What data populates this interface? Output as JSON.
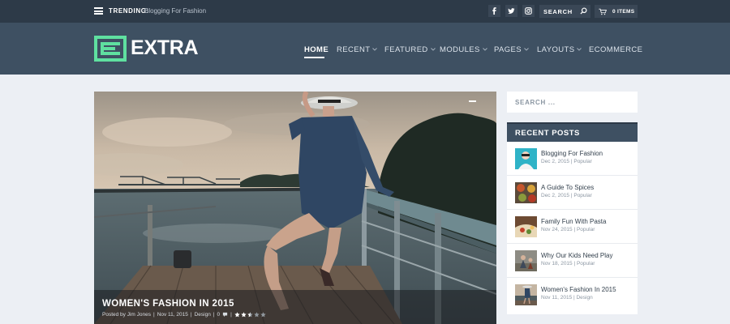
{
  "topbar": {
    "trending_label": "TRENDING:",
    "trending_link": "Blogging For Fashion",
    "search_placeholder": "SEARCH",
    "cart_label": "0 ITEMS"
  },
  "header": {
    "logo_text": "EXTRA",
    "nav": [
      {
        "label": "HOME"
      },
      {
        "label": "RECENT"
      },
      {
        "label": "FEATURED"
      },
      {
        "label": "MODULES"
      },
      {
        "label": "PAGES"
      },
      {
        "label": "LAYOUTS"
      },
      {
        "label": "ECOMMERCE"
      }
    ]
  },
  "hero": {
    "title": "WOMEN'S FASHION IN 2015",
    "author": "Posted by Jim Jones",
    "date": "Nov 11, 2015",
    "category": "Design",
    "comments": "0",
    "rating": 2.5,
    "rating_max": 5
  },
  "sidebar": {
    "search_placeholder": "SEARCH ...",
    "recent_title": "RECENT POSTS",
    "posts": [
      {
        "title": "Blogging For Fashion",
        "meta": "Dec 2, 2015 | Popular"
      },
      {
        "title": "A Guide To Spices",
        "meta": "Dec 2, 2015 | Popular"
      },
      {
        "title": "Family Fun With Pasta",
        "meta": "Nov 24, 2015 | Popular"
      },
      {
        "title": "Why Our Kids Need Play",
        "meta": "Nov 18, 2015 | Popular"
      },
      {
        "title": "Women's Fashion In 2015",
        "meta": "Nov 11, 2015 | Design"
      }
    ]
  },
  "colors": {
    "topbar_bg": "#2d3a48",
    "header_bg": "#3e5062",
    "page_bg": "#eceff4",
    "logo_accent": "#5fe0a0",
    "text_dark": "#33404d",
    "text_muted": "#8b96a2"
  },
  "icons": {
    "menu": "hamburger-icon",
    "facebook": "facebook-icon",
    "twitter": "twitter-icon",
    "instagram": "instagram-icon",
    "search": "search-icon",
    "cart": "cart-icon",
    "dropdown": "chevron-down-icon",
    "comments": "comment-icon",
    "rating": "star-icon"
  }
}
